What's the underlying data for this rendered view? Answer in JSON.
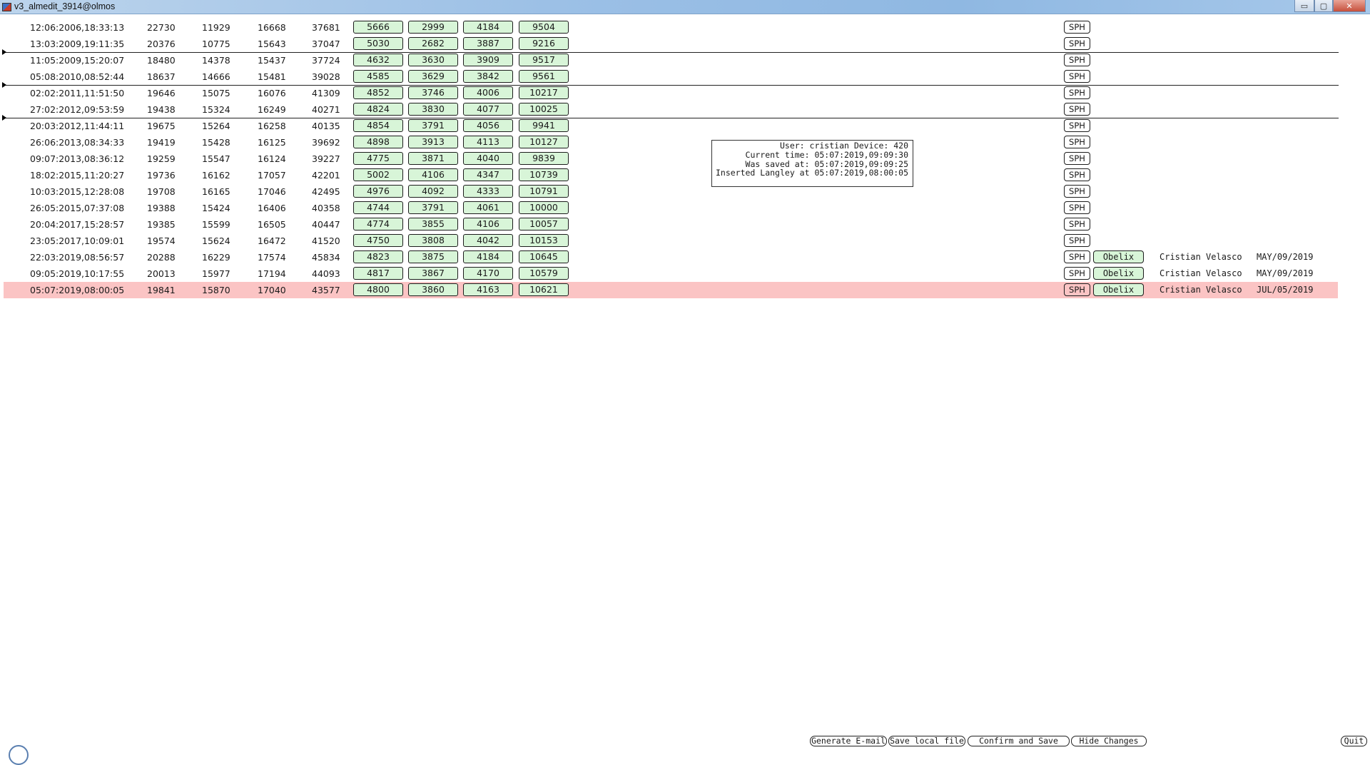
{
  "window": {
    "title": "v3_almedit_3914@olmos",
    "minimize_glyph": "▭",
    "maximize_glyph": "▢",
    "close_glyph": "✕"
  },
  "rows": [
    {
      "date": "12:06:2006,18:33:13",
      "v": [
        "22730",
        "11929",
        "16668",
        "37681"
      ],
      "g": [
        "5666",
        "2999",
        "4184",
        "9504"
      ],
      "sph": "SPH"
    },
    {
      "date": "13:03:2009,19:11:35",
      "v": [
        "20376",
        "10775",
        "15643",
        "37047"
      ],
      "g": [
        "5030",
        "2682",
        "3887",
        "9216"
      ],
      "sph": "SPH"
    },
    {
      "date": "11:05:2009,15:20:07",
      "v": [
        "18480",
        "14378",
        "15437",
        "37724"
      ],
      "g": [
        "4632",
        "3630",
        "3909",
        "9517"
      ],
      "sph": "SPH"
    },
    {
      "date": "05:08:2010,08:52:44",
      "v": [
        "18637",
        "14666",
        "15481",
        "39028"
      ],
      "g": [
        "4585",
        "3629",
        "3842",
        "9561"
      ],
      "sph": "SPH"
    },
    {
      "date": "02:02:2011,11:51:50",
      "v": [
        "19646",
        "15075",
        "16076",
        "41309"
      ],
      "g": [
        "4852",
        "3746",
        "4006",
        "10217"
      ],
      "sph": "SPH"
    },
    {
      "date": "27:02:2012,09:53:59",
      "v": [
        "19438",
        "15324",
        "16249",
        "40271"
      ],
      "g": [
        "4824",
        "3830",
        "4077",
        "10025"
      ],
      "sph": "SPH"
    },
    {
      "date": "20:03:2012,11:44:11",
      "v": [
        "19675",
        "15264",
        "16258",
        "40135"
      ],
      "g": [
        "4854",
        "3791",
        "4056",
        "9941"
      ],
      "sph": "SPH"
    },
    {
      "date": "26:06:2013,08:34:33",
      "v": [
        "19419",
        "15428",
        "16125",
        "39692"
      ],
      "g": [
        "4898",
        "3913",
        "4113",
        "10127"
      ],
      "sph": "SPH"
    },
    {
      "date": "09:07:2013,08:36:12",
      "v": [
        "19259",
        "15547",
        "16124",
        "39227"
      ],
      "g": [
        "4775",
        "3871",
        "4040",
        "9839"
      ],
      "sph": "SPH"
    },
    {
      "date": "18:02:2015,11:20:27",
      "v": [
        "19736",
        "16162",
        "17057",
        "42201"
      ],
      "g": [
        "5002",
        "4106",
        "4347",
        "10739"
      ],
      "sph": "SPH"
    },
    {
      "date": "10:03:2015,12:28:08",
      "v": [
        "19708",
        "16165",
        "17046",
        "42495"
      ],
      "g": [
        "4976",
        "4092",
        "4333",
        "10791"
      ],
      "sph": "SPH"
    },
    {
      "date": "26:05:2015,07:37:08",
      "v": [
        "19388",
        "15424",
        "16406",
        "40358"
      ],
      "g": [
        "4744",
        "3791",
        "4061",
        "10000"
      ],
      "sph": "SPH"
    },
    {
      "date": "20:04:2017,15:28:57",
      "v": [
        "19385",
        "15599",
        "16505",
        "40447"
      ],
      "g": [
        "4774",
        "3855",
        "4106",
        "10057"
      ],
      "sph": "SPH"
    },
    {
      "date": "23:05:2017,10:09:01",
      "v": [
        "19574",
        "15624",
        "16472",
        "41520"
      ],
      "g": [
        "4750",
        "3808",
        "4042",
        "10153"
      ],
      "sph": "SPH"
    },
    {
      "date": "22:03:2019,08:56:57",
      "v": [
        "20288",
        "16229",
        "17574",
        "45834"
      ],
      "g": [
        "4823",
        "3875",
        "4184",
        "10645"
      ],
      "sph": "SPH",
      "obelix": "Obelix",
      "person": "Cristian Velasco",
      "pdate": "MAY/09/2019"
    },
    {
      "date": "09:05:2019,10:17:55",
      "v": [
        "20013",
        "15977",
        "17194",
        "44093"
      ],
      "g": [
        "4817",
        "3867",
        "4170",
        "10579"
      ],
      "sph": "SPH",
      "obelix": "Obelix",
      "person": "Cristian Velasco",
      "pdate": "MAY/09/2019"
    },
    {
      "date": "05:07:2019,08:00:05",
      "v": [
        "19841",
        "15870",
        "17040",
        "43577"
      ],
      "g": [
        "4800",
        "3860",
        "4163",
        "10621"
      ],
      "sph": "SPH",
      "obelix": "Obelix",
      "person": "Cristian Velasco",
      "pdate": "JUL/05/2019",
      "highlight": true
    }
  ],
  "info": {
    "line1": "User: cristian Device: 420",
    "line2": "Current time: 05:07:2019,09:09:30",
    "line3": "Was saved at: 05:07:2019,09:09:25",
    "line4": "Inserted Langley at 05:07:2019,08:00:05"
  },
  "buttons": {
    "generate_email": "Generate E-mail",
    "save_local": "Save local file",
    "confirm_save": "Confirm and Save",
    "hide_changes": "Hide Changes",
    "quit": "Quit"
  },
  "colors": {
    "green_button": "#d8f5d8",
    "highlight_row": "#fbc4c4",
    "titlebar": "#9cc0e6"
  }
}
